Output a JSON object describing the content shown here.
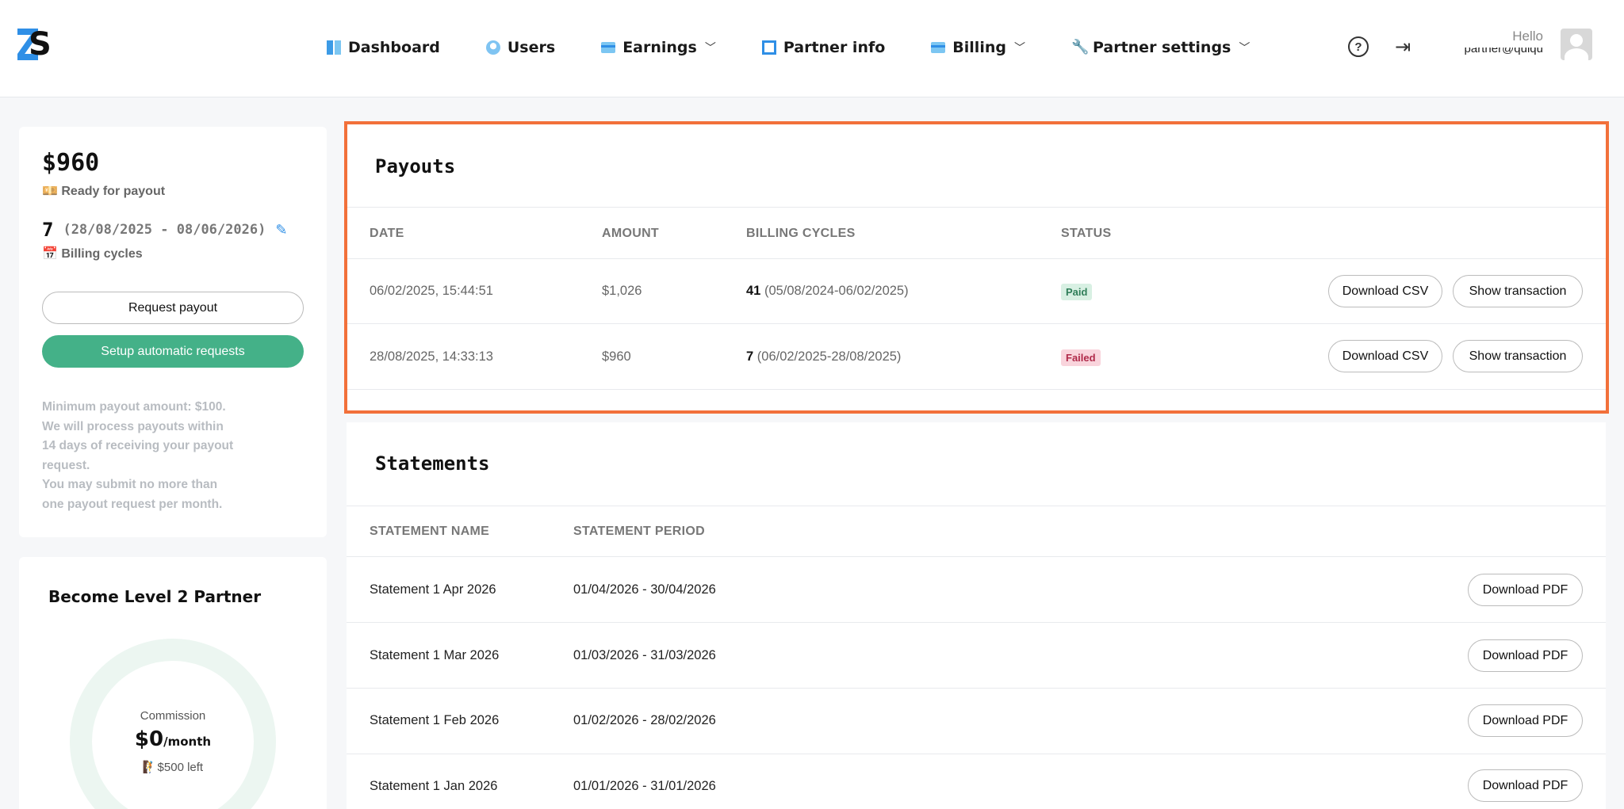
{
  "nav": {
    "items": [
      {
        "label": "Dashboard",
        "icon": "dashboard-icon"
      },
      {
        "label": "Users",
        "icon": "user-icon"
      },
      {
        "label": "Earnings",
        "icon": "card-icon"
      },
      {
        "label": "Partner info",
        "icon": "partner-square-icon"
      },
      {
        "label": "Billing",
        "icon": "card-icon"
      },
      {
        "label": "Partner settings",
        "icon": "wrench-icon"
      }
    ],
    "hello": "Hello",
    "user_name": "partner@quiqu"
  },
  "balance": {
    "amount": "$960",
    "ready_label": "💴 Ready for payout",
    "cycles_count": "7",
    "cycles_range": "(28/08/2025 - 08/06/2026)",
    "cycles_label": "📅 Billing cycles",
    "request_button": "Request payout",
    "automatic_button": "Setup automatic requests",
    "info_lines": [
      "Minimum payout amount: $100.",
      "We will process payouts within",
      "14 days of receiving your payout",
      "request.",
      "You may submit no more than",
      "one payout request per month."
    ]
  },
  "level": {
    "title": "Become Level 2 Partner",
    "commission_label": "Commission",
    "commission_value": "$0",
    "commission_unit": "/month",
    "left_text": "🧗$500 left"
  },
  "payouts": {
    "title": "Payouts",
    "headers": [
      "DATE",
      "AMOUNT",
      "BILLING CYCLES",
      "STATUS"
    ],
    "rows": [
      {
        "date": "06/02/2025, 15:44:51",
        "amount": "$1,026",
        "cycles_count": "41",
        "cycles_range": " (05/08/2024-06/02/2025)",
        "status": "Paid",
        "csv_button": "Download CSV",
        "tx_button": "Show transaction"
      },
      {
        "date": "28/08/2025, 14:33:13",
        "amount": "$960",
        "cycles_count": "7",
        "cycles_range": " (06/02/2025-28/08/2025)",
        "status": "Failed",
        "csv_button": "Download CSV",
        "tx_button": "Show transaction"
      }
    ]
  },
  "statements": {
    "title": "Statements",
    "headers": [
      "STATEMENT NAME",
      "STATEMENT PERIOD"
    ],
    "rows": [
      {
        "name": "Statement 1 Apr 2026",
        "period": "01/04/2026 - 30/04/2026",
        "button": "Download PDF"
      },
      {
        "name": "Statement 1 Mar 2026",
        "period": "01/03/2026 - 31/03/2026",
        "button": "Download PDF"
      },
      {
        "name": "Statement 1 Feb 2026",
        "period": "01/02/2026 - 28/02/2026",
        "button": "Download PDF"
      },
      {
        "name": "Statement 1 Jan 2026",
        "period": "01/01/2026 - 31/01/2026",
        "button": "Download PDF"
      }
    ]
  },
  "colors": {
    "accent_blue": "#2f8fe6",
    "green_button": "#44b188",
    "highlight_border": "#f2703a",
    "paid_badge": "#d8f0e3",
    "failed_badge": "#f9d4dc"
  }
}
